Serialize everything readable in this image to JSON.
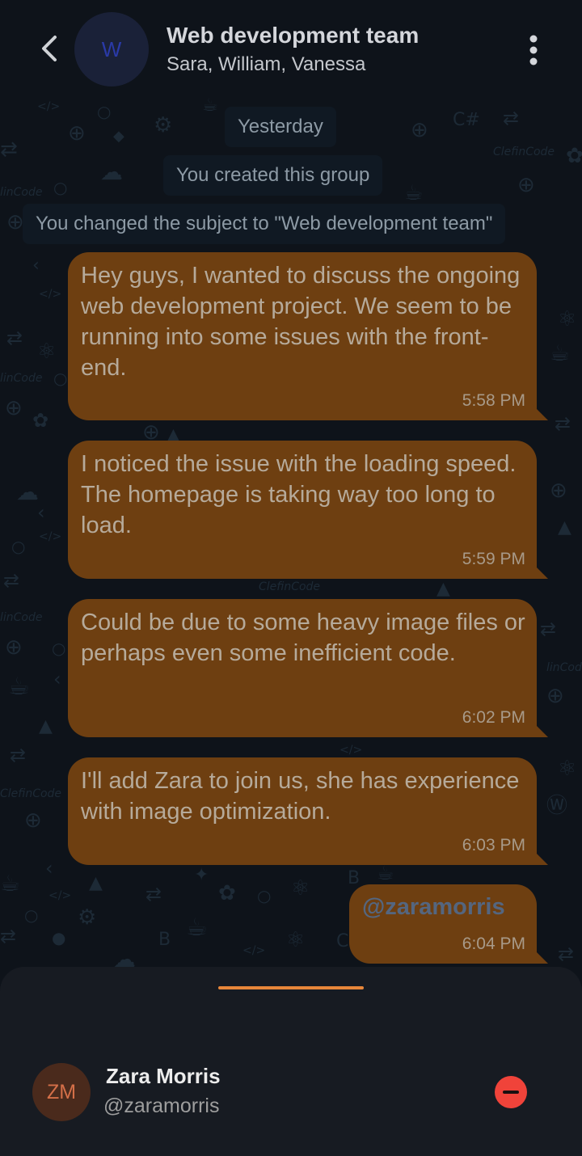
{
  "header": {
    "avatar_letter": "W",
    "title": "Web development team",
    "members": "Sara, William, Vanessa"
  },
  "system": {
    "date": "Yesterday",
    "created": "You created this group",
    "subject_changed": "You changed the subject to \"Web development team\""
  },
  "messages": [
    {
      "text": "Hey guys, I wanted to discuss the ongoing web development project. We seem to be running into some issues with the front-end.",
      "time": "5:58 PM"
    },
    {
      "text": "I noticed the issue with the loading speed. The homepage is taking way too long to load.",
      "time": "5:59 PM"
    },
    {
      "text": "Could be due to some heavy image files or perhaps even some inefficient code.",
      "time": "6:02 PM"
    },
    {
      "text": "I'll add Zara to join us, she has experience with image optimization.",
      "time": "6:03 PM"
    }
  ],
  "mention_message": {
    "text": "@zaramorris",
    "time": "6:04 PM"
  },
  "mention_sheet": {
    "user": {
      "initials": "ZM",
      "name": "Zara Morris",
      "handle": "@zaramorris"
    }
  },
  "icons": {
    "back": "chevron-left-icon",
    "menu": "more-vertical-icon",
    "remove": "remove-circle-icon"
  },
  "colors": {
    "background": "#0e131a",
    "bubble": "#6e3f11",
    "handle_bar": "#e8873a",
    "remove": "#f0433a",
    "mention_link": "#546680"
  }
}
